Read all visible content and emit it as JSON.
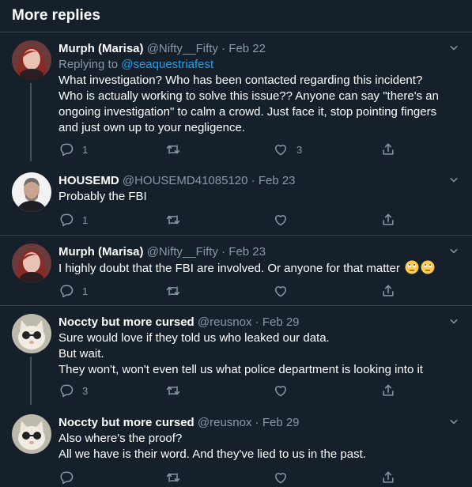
{
  "header": {
    "title": "More replies"
  },
  "tweets": [
    {
      "name": "Murph (Marisa)",
      "handle": "@Nifty__Fifty",
      "date": "Feb 22",
      "replying_prefix": "Replying to ",
      "replying_to": "@seaquestriafest",
      "text": "What investigation? Who has been contacted regarding this incident? Who is actually working to solve this issue?? Anyone can say \"there's an ongoing investigation\" to calm a crowd. Just face it, stop pointing fingers and just own up to your negligence.",
      "replies": "1",
      "retweets": "",
      "likes": "3"
    },
    {
      "name": "HOUSEMD",
      "handle": "@HOUSEMD41085120",
      "date": "Feb 23",
      "text": "Probably the FBI",
      "replies": "1",
      "retweets": "",
      "likes": ""
    },
    {
      "name": "Murph (Marisa)",
      "handle": "@Nifty__Fifty",
      "date": "Feb 23",
      "text": "I highly doubt that the FBI are involved. Or anyone for that matter",
      "replies": "1",
      "retweets": "",
      "likes": ""
    },
    {
      "name": "Noccty but more cursed",
      "handle": "@reusnox",
      "date": "Feb 29",
      "text": "Sure would love if they told us who leaked our data.\nBut wait.\nThey won't, won't even tell us what police department is looking into it",
      "replies": "3",
      "retweets": "",
      "likes": ""
    },
    {
      "name": "Noccty but more cursed",
      "handle": "@reusnox",
      "date": "Feb 29",
      "text": "Also where's the proof?\nAll we have is their word. And they've lied to us in the past.",
      "replies": "",
      "retweets": "",
      "likes": ""
    }
  ],
  "meta_separator": " · ",
  "colors": {
    "background": "#15202b",
    "muted": "#8899a6",
    "link": "#1da1f2",
    "divider": "#38444d"
  }
}
